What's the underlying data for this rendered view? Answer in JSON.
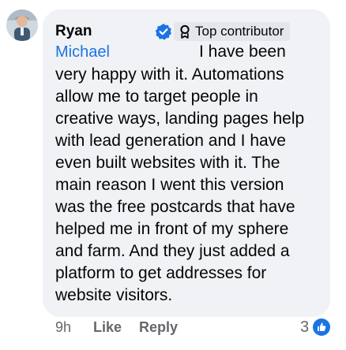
{
  "comment": {
    "author_first": "Ryan",
    "author_second": "Michael",
    "badge_label": "Top contributor",
    "first_line_tail": "I have been",
    "body_lines": [
      "very happy with it. Automations",
      "allow me to target people in",
      "creative ways, landing pages help",
      "with lead generation and I have",
      "even built websites with it. The",
      "main reason I went this version",
      "was the free postcards that have",
      "helped me in front of my sphere",
      "and farm. And they just added a",
      "platform to get addresses for",
      "website visitors."
    ],
    "timestamp": "9h",
    "like_label": "Like",
    "reply_label": "Reply",
    "reaction_count": "3"
  },
  "icons": {
    "verified": "verified-badge-icon",
    "badge": "top-contributor-icon",
    "reaction": "like-reaction-icon"
  },
  "colors": {
    "bubble": "#f0f2f5",
    "link": "#1b74e4",
    "text": "#050505",
    "secondary": "#65676b",
    "badge_bg": "#e4e6eb"
  }
}
